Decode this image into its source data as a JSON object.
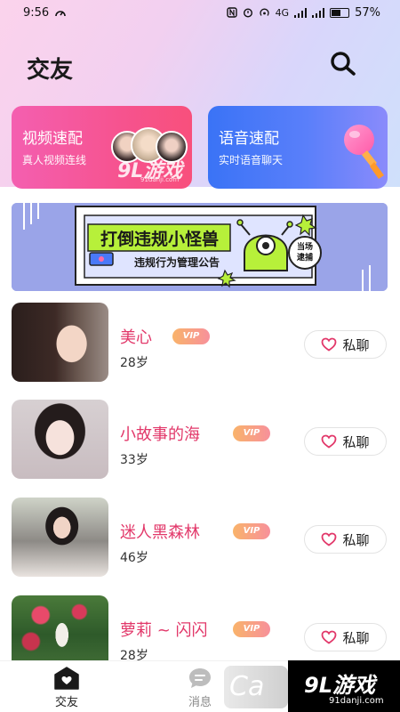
{
  "status_bar": {
    "time": "9:56",
    "network": "4G",
    "battery_pct_label": "57%",
    "battery_level": 0.57
  },
  "header": {
    "title": "交友",
    "search_icon": "search-icon"
  },
  "quick_match": [
    {
      "title": "视频速配",
      "subtitle": "真人视频连线",
      "color": "#f65a95"
    },
    {
      "title": "语音速配",
      "subtitle": "实时语音聊天",
      "color": "#4a79f8"
    }
  ],
  "banner": {
    "title": "打倒违规小怪兽",
    "subtitle": "违规行为管理公告",
    "stamp_line1": "当场",
    "stamp_line2": "逮捕",
    "accent": "#b7f03a",
    "bg": "#9aa4e8"
  },
  "users": [
    {
      "name": "美心",
      "badge": "VIP",
      "age": "28岁",
      "action": "私聊"
    },
    {
      "name": "小故事的海",
      "badge": "VIP",
      "age": "33岁",
      "action": "私聊"
    },
    {
      "name": "迷人黑森林",
      "badge": "VIP",
      "age": "46岁",
      "action": "私聊"
    },
    {
      "name": "萝莉 ~ 闪闪",
      "badge": "VIP",
      "age": "28岁",
      "action": "私聊"
    }
  ],
  "tabbar": {
    "friends": "交友",
    "messages": "消息"
  },
  "watermark": {
    "brand": "9L游戏",
    "url": "91danji.com",
    "ghost": "Ca"
  },
  "colors": {
    "name_pink": "#e2386a",
    "vip_from": "#f9b36a",
    "vip_to": "#f7909b"
  }
}
